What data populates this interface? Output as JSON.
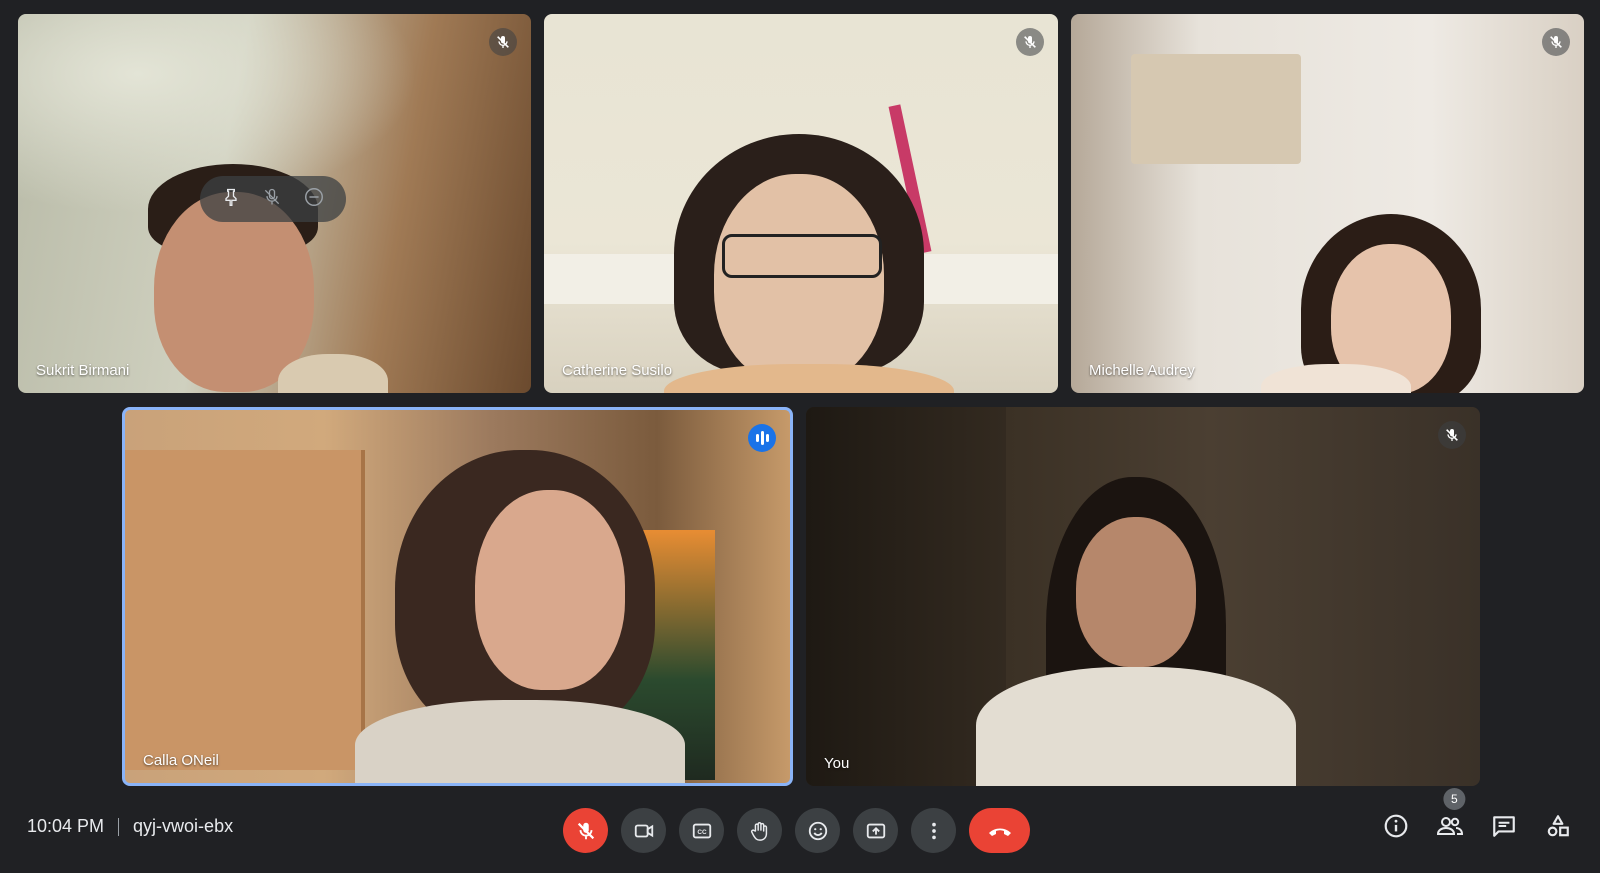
{
  "participants": [
    {
      "name": "Sukrit Birmani"
    },
    {
      "name": "Catherine Susilo"
    },
    {
      "name": "Michelle Audrey"
    },
    {
      "name": "Calla ONeil"
    },
    {
      "name": "You"
    }
  ],
  "hover_menu": {
    "icons": [
      "pin-icon",
      "mute-icon",
      "remove-icon"
    ]
  },
  "bottom_bar": {
    "time": "10:04 PM",
    "meeting_code": "qyj-vwoi-ebx",
    "people_count": "5"
  },
  "colors": {
    "active_speaker": "#1a73e8",
    "end_call": "#ea4335",
    "background": "#202124"
  }
}
